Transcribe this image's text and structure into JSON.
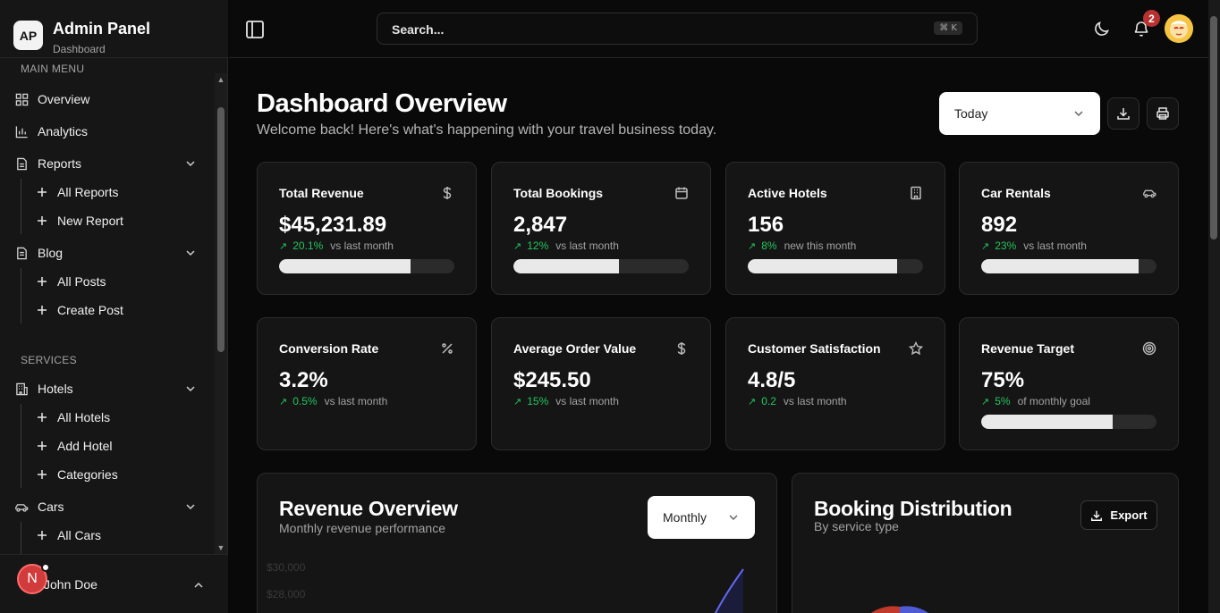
{
  "brand": {
    "logo": "AP",
    "title": "Admin Panel",
    "subtitle": "Dashboard"
  },
  "sidebar": {
    "section_main": "MAIN MENU",
    "section_services": "SERVICES",
    "items": [
      {
        "label": "Overview",
        "icon": "grid-icon"
      },
      {
        "label": "Analytics",
        "icon": "bar-chart-icon"
      },
      {
        "label": "Reports",
        "icon": "file-icon",
        "sub": [
          "All Reports",
          "New Report"
        ]
      },
      {
        "label": "Blog",
        "icon": "file-text-icon",
        "sub": [
          "All Posts",
          "Create Post"
        ]
      },
      {
        "label": "Hotels",
        "icon": "building-icon",
        "sub": [
          "All Hotels",
          "Add Hotel",
          "Categories"
        ]
      },
      {
        "label": "Cars",
        "icon": "car-icon",
        "sub": [
          "All Cars"
        ]
      }
    ],
    "user": {
      "initial": "N",
      "name": "John Doe"
    }
  },
  "topbar": {
    "search_placeholder": "Search...",
    "shortcut": "⌘ K",
    "notifications": "2"
  },
  "page": {
    "title": "Dashboard Overview",
    "subtitle": "Welcome back! Here's what's happening with your travel business today.",
    "period": "Today"
  },
  "stats": [
    {
      "title": "Total Revenue",
      "value": "$45,231.89",
      "delta": "20.1%",
      "note": "vs last month",
      "progress": 0.75,
      "icon": "dollar-icon"
    },
    {
      "title": "Total Bookings",
      "value": "2,847",
      "delta": "12%",
      "note": "vs last month",
      "progress": 0.6,
      "icon": "calendar-icon"
    },
    {
      "title": "Active Hotels",
      "value": "156",
      "delta": "8%",
      "note": "new this month",
      "progress": 0.85,
      "icon": "hotel-icon"
    },
    {
      "title": "Car Rentals",
      "value": "892",
      "delta": "23%",
      "note": "vs last month",
      "progress": 0.9,
      "icon": "car-icon"
    },
    {
      "title": "Conversion Rate",
      "value": "3.2%",
      "delta": "0.5%",
      "note": "vs last month",
      "icon": "percent-icon"
    },
    {
      "title": "Average Order Value",
      "value": "$245.50",
      "delta": "15%",
      "note": "vs last month",
      "icon": "dollar-icon"
    },
    {
      "title": "Customer Satisfaction",
      "value": "4.8/5",
      "delta": "0.2",
      "note": "vs last month",
      "icon": "star-icon"
    },
    {
      "title": "Revenue Target",
      "value": "75%",
      "delta": "5%",
      "note": "of monthly goal",
      "progress": 0.75,
      "icon": "target-icon"
    }
  ],
  "revenue_panel": {
    "title": "Revenue Overview",
    "subtitle": "Monthly revenue performance",
    "period": "Monthly",
    "ticks": [
      "$30,000",
      "$28,000"
    ]
  },
  "booking_panel": {
    "title": "Booking Distribution",
    "subtitle": "By service type",
    "export": "Export"
  },
  "colors": {
    "accent_green": "#22c55e",
    "chart_line": "#6366f1",
    "badge_red": "#b83232"
  }
}
